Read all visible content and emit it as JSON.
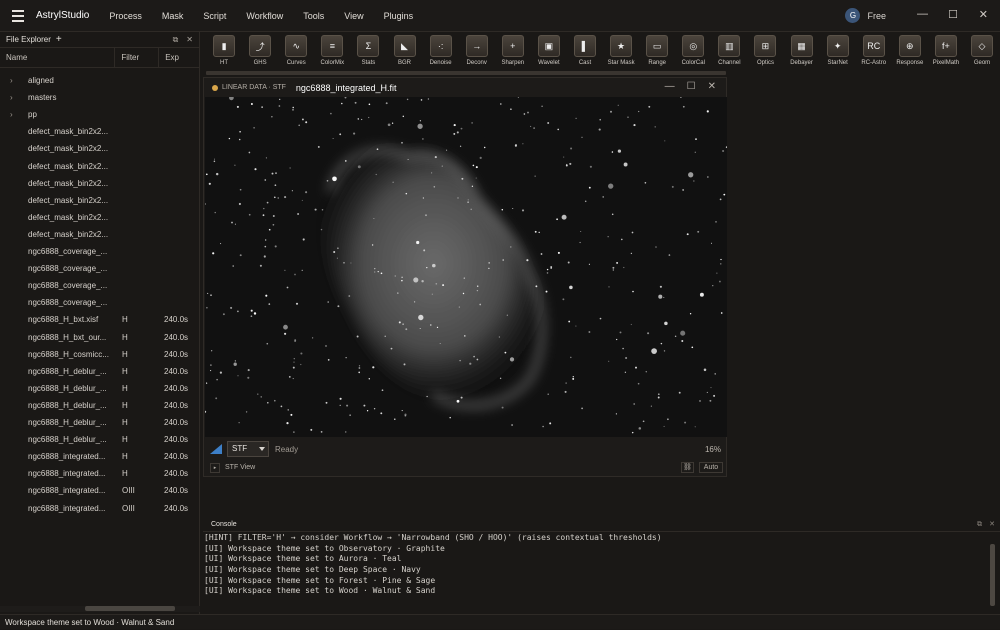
{
  "app": {
    "name": "AstrylStudio",
    "menus": [
      "Process",
      "Mask",
      "Script",
      "Workflow",
      "Tools",
      "View",
      "Plugins"
    ],
    "user_initial": "G",
    "plan": "Free"
  },
  "explorer": {
    "title": "File Explorer",
    "columns": [
      "Name",
      "Filter",
      "Exp"
    ],
    "rows": [
      {
        "name": "aligned",
        "filter": "",
        "exp": "",
        "folder": true
      },
      {
        "name": "masters",
        "filter": "",
        "exp": "",
        "folder": true
      },
      {
        "name": "pp",
        "filter": "",
        "exp": "",
        "folder": true
      },
      {
        "name": "defect_mask_bin2x2...",
        "filter": "",
        "exp": ""
      },
      {
        "name": "defect_mask_bin2x2...",
        "filter": "",
        "exp": ""
      },
      {
        "name": "defect_mask_bin2x2...",
        "filter": "",
        "exp": ""
      },
      {
        "name": "defect_mask_bin2x2...",
        "filter": "",
        "exp": ""
      },
      {
        "name": "defect_mask_bin2x2...",
        "filter": "",
        "exp": ""
      },
      {
        "name": "defect_mask_bin2x2...",
        "filter": "",
        "exp": ""
      },
      {
        "name": "defect_mask_bin2x2...",
        "filter": "",
        "exp": ""
      },
      {
        "name": "ngc6888_coverage_...",
        "filter": "",
        "exp": ""
      },
      {
        "name": "ngc6888_coverage_...",
        "filter": "",
        "exp": ""
      },
      {
        "name": "ngc6888_coverage_...",
        "filter": "",
        "exp": ""
      },
      {
        "name": "ngc6888_coverage_...",
        "filter": "",
        "exp": ""
      },
      {
        "name": "ngc6888_H_bxt.xisf",
        "filter": "H",
        "exp": "240.0s"
      },
      {
        "name": "ngc6888_H_bxt_our...",
        "filter": "H",
        "exp": "240.0s"
      },
      {
        "name": "ngc6888_H_cosmicc...",
        "filter": "H",
        "exp": "240.0s"
      },
      {
        "name": "ngc6888_H_deblur_...",
        "filter": "H",
        "exp": "240.0s"
      },
      {
        "name": "ngc6888_H_deblur_...",
        "filter": "H",
        "exp": "240.0s"
      },
      {
        "name": "ngc6888_H_deblur_...",
        "filter": "H",
        "exp": "240.0s"
      },
      {
        "name": "ngc6888_H_deblur_...",
        "filter": "H",
        "exp": "240.0s"
      },
      {
        "name": "ngc6888_H_deblur_...",
        "filter": "H",
        "exp": "240.0s"
      },
      {
        "name": "ngc6888_integrated...",
        "filter": "H",
        "exp": "240.0s"
      },
      {
        "name": "ngc6888_integrated...",
        "filter": "H",
        "exp": "240.0s"
      },
      {
        "name": "ngc6888_integrated...",
        "filter": "OIII",
        "exp": "240.0s"
      },
      {
        "name": "ngc6888_integrated...",
        "filter": "OIII",
        "exp": "240.0s"
      }
    ]
  },
  "tools": [
    "HT",
    "GHS",
    "Curves",
    "ColorMix",
    "Stats",
    "BGR",
    "Denoise",
    "Deconv",
    "Sharpen",
    "Wavelet",
    "Cast",
    "Star Mask",
    "Range",
    "ColorCal",
    "Channel",
    "Optics",
    "Debayer",
    "StarNet",
    "RC-Astro",
    "Response",
    "PixelMath",
    "Geom"
  ],
  "image_window": {
    "badge": "LINEAR DATA · STF",
    "filename": "ngc6888_integrated_H.fit",
    "stf": "STF",
    "status": "Ready",
    "zoom": "16%",
    "stf_view": "STF View",
    "auto": "Auto"
  },
  "console": {
    "title": "Console",
    "lines": [
      "[HINT] FILTER='H' → consider Workflow → 'Narrowband (SHO / HOO)' (raises contextual thresholds)",
      "[UI] Workspace theme set to Observatory · Graphite",
      "[UI] Workspace theme set to Aurora · Teal",
      "[UI] Workspace theme set to Deep Space · Navy",
      "[UI] Workspace theme set to Forest · Pine & Sage",
      "[UI] Workspace theme set to Wood · Walnut & Sand"
    ]
  },
  "statusbar": "Workspace theme set to Wood · Walnut & Sand"
}
